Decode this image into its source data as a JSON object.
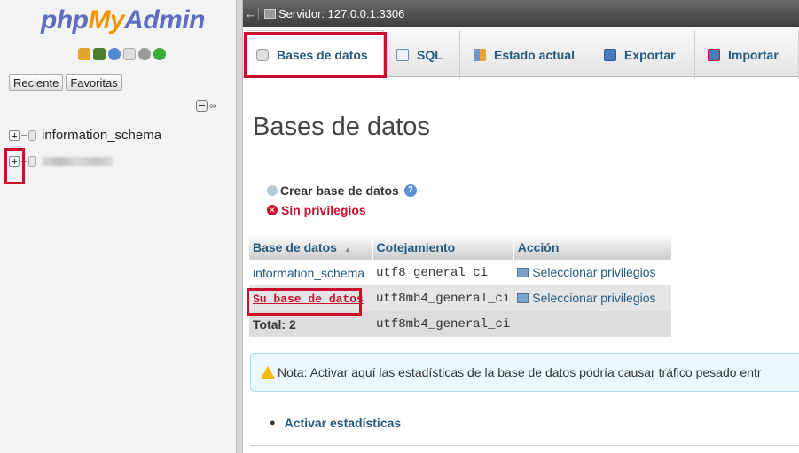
{
  "sidebar": {
    "logo": {
      "php": "php",
      "my": "My",
      "admin": "Admin"
    },
    "nav_icons": [
      "home-icon",
      "exit-icon",
      "help-icon",
      "docs-icon",
      "settings-icon",
      "reload-icon"
    ],
    "recent_label": "Reciente",
    "favorites_label": "Favoritas",
    "tree": [
      {
        "label": "information_schema"
      },
      {
        "label": ""
      }
    ]
  },
  "server_bar": {
    "text": "Servidor: 127.0.0.1:3306"
  },
  "tabs": [
    {
      "label": "Bases de datos",
      "icon": "database-icon",
      "active": true
    },
    {
      "label": "SQL",
      "icon": "sql-icon"
    },
    {
      "label": "Estado actual",
      "icon": "status-icon"
    },
    {
      "label": "Exportar",
      "icon": "export-icon"
    },
    {
      "label": "Importar",
      "icon": "import-icon"
    }
  ],
  "main": {
    "heading": "Bases de datos",
    "create_db": "Crear base de datos",
    "no_privileges": "Sin privilegios",
    "table": {
      "headers": [
        "Base de datos",
        "Cotejamiento",
        "Acción"
      ],
      "rows": [
        {
          "name": "information_schema",
          "collation": "utf8_general_ci",
          "action": "Seleccionar privilegios"
        },
        {
          "name": "Su_base_de_datos",
          "collation": "utf8mb4_general_ci",
          "action": "Seleccionar privilegios"
        }
      ],
      "total_label": "Total: 2",
      "total_collation": "utf8mb4_general_ci"
    },
    "notice": "Nota: Activar aquí las estadísticas de la base de datos podría causar tráfico pesado entr",
    "stats_link": "Activar estadísticas"
  },
  "colors": {
    "accent_red": "#c8102e",
    "link_blue": "#235a81",
    "logo_blue": "#5f6dc0",
    "logo_orange": "#f29400"
  }
}
